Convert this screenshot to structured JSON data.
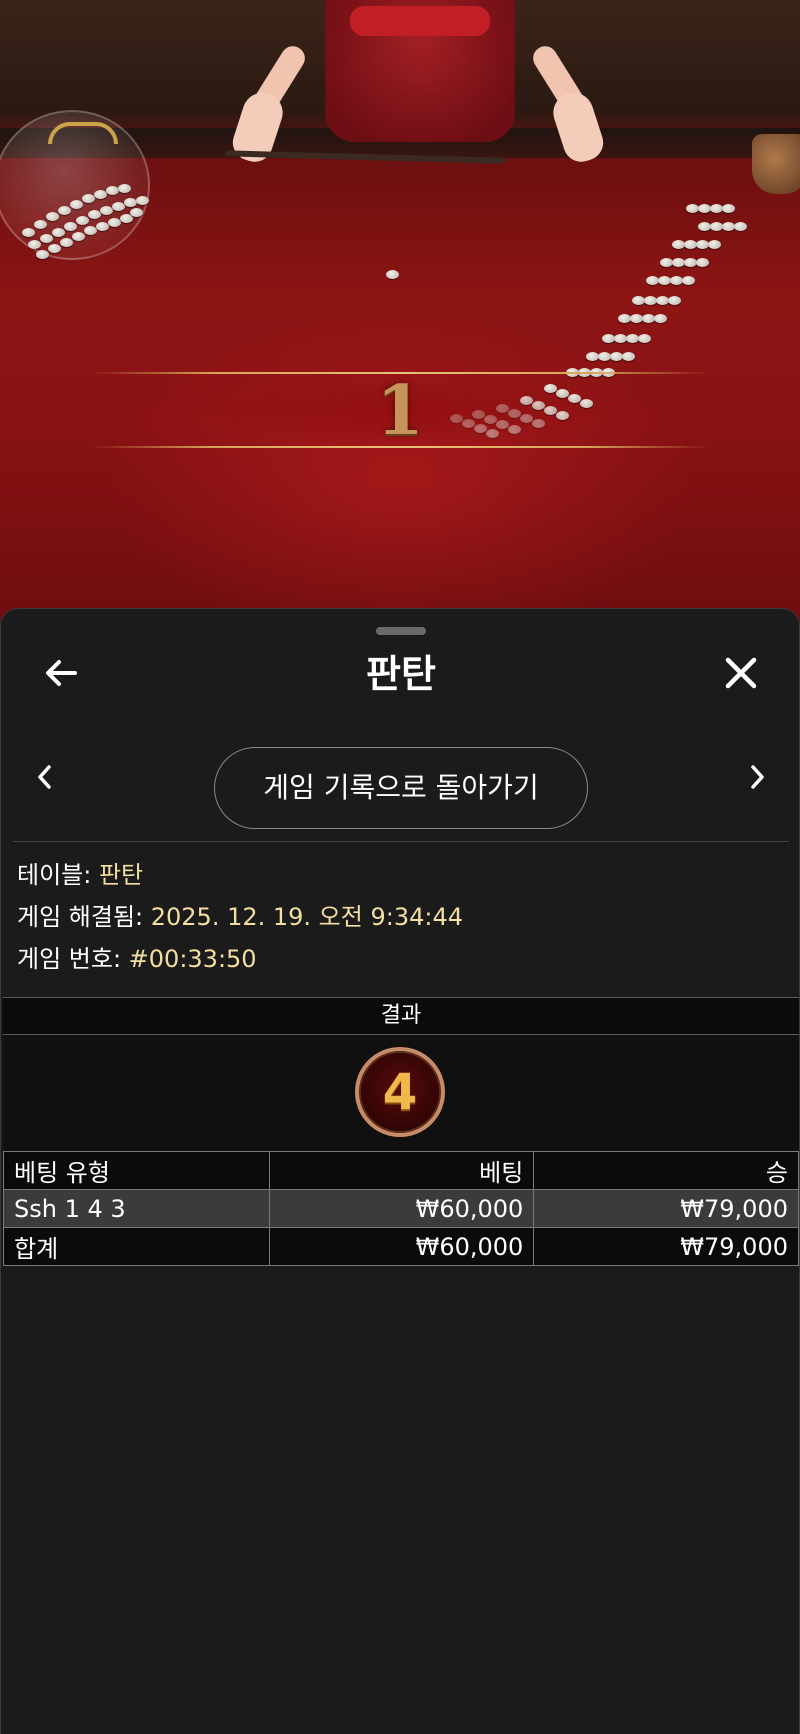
{
  "scene": {
    "table_number": "1"
  },
  "sheet": {
    "title": "판탄",
    "history_button_label": "게임 기록으로 돌아가기"
  },
  "info": {
    "table_label": "테이블: ",
    "table_value": "판탄",
    "resolved_label": "게임 해결됨: ",
    "resolved_value": "2025. 12. 19. 오전 9:34:44",
    "game_number_label": "게임 번호: ",
    "game_number_value": "#00:33:50"
  },
  "result": {
    "header": "결과",
    "value": "4"
  },
  "bets_table": {
    "headers": [
      "베팅 유형",
      "베팅",
      "승"
    ],
    "rows": [
      [
        "Ssh 1 4 3",
        "₩60,000",
        "₩79,000"
      ]
    ],
    "total": [
      "합계",
      "₩60,000",
      "₩79,000"
    ]
  },
  "icons": [
    "arrow-left-icon",
    "close-icon",
    "chevron-left-icon",
    "chevron-right-icon"
  ],
  "colors": {
    "sheet_bg": "#1b1b1b",
    "info_value": "#f4dfa0",
    "felt_red": "#8d1514",
    "result_ball_gold": "#f0b84b",
    "highlight_row": "#3b3b3b"
  }
}
